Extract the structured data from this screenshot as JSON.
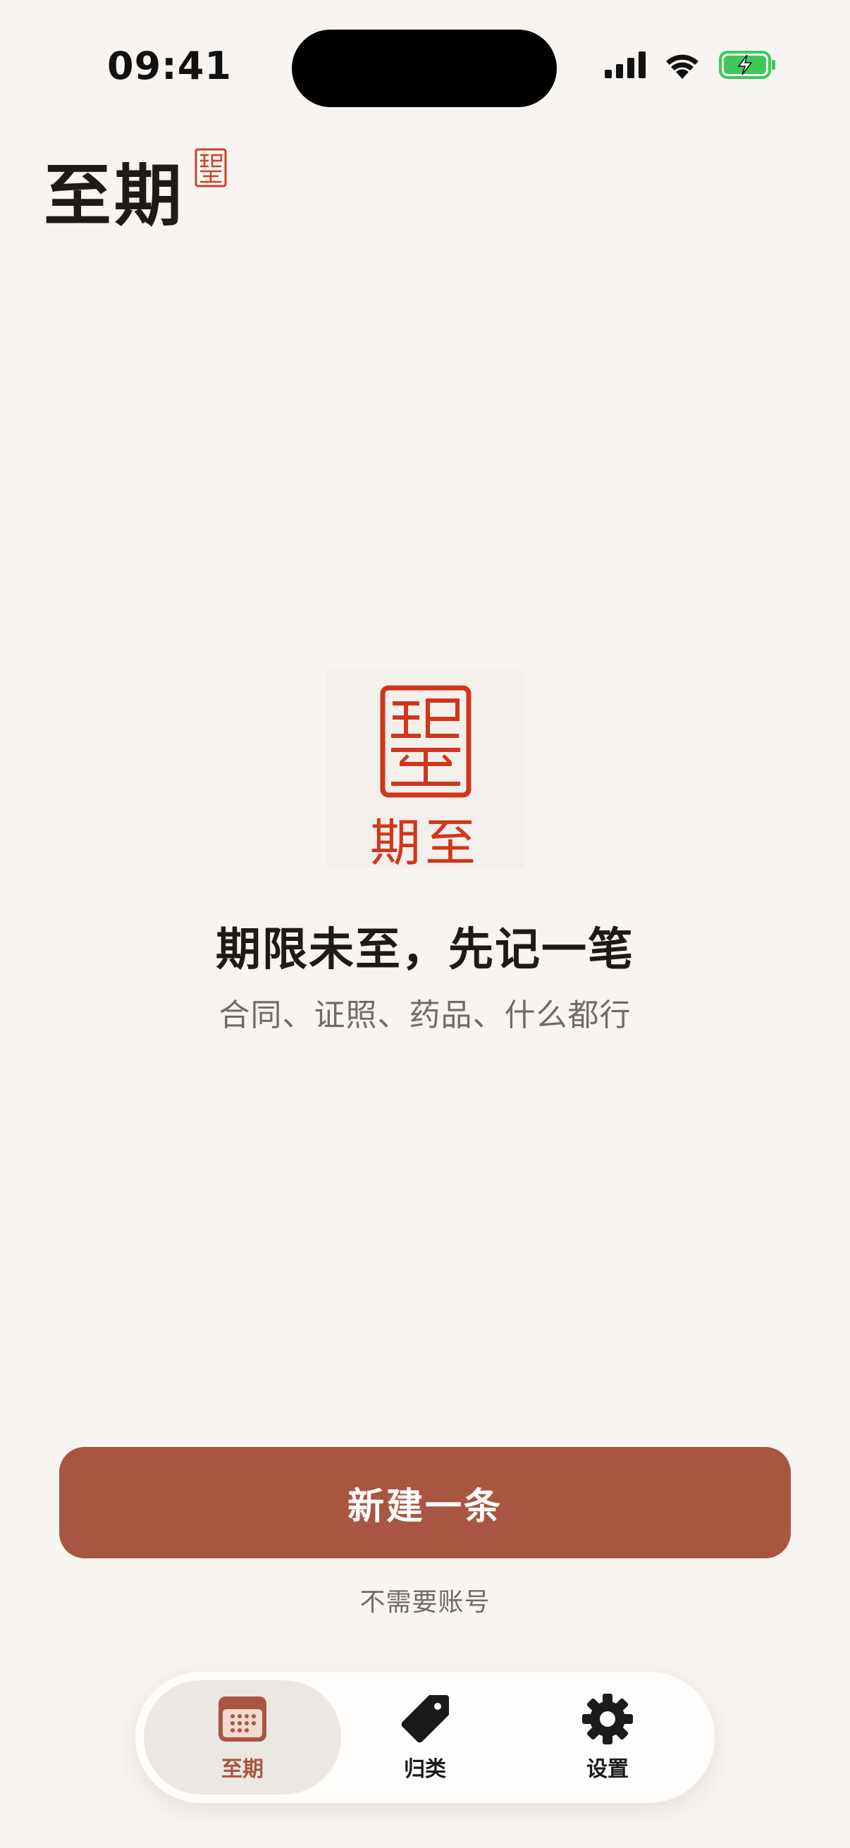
{
  "status_bar": {
    "time": "09:41",
    "icons": [
      "signal-icon",
      "wifi-icon",
      "battery-charging-icon"
    ]
  },
  "header": {
    "title": "至期",
    "seal_icon": "seal-icon"
  },
  "empty_state": {
    "logo_icon": "seal-logo-icon",
    "logo_text": "期至",
    "heading": "期限未至，先记一笔",
    "subtitle": "合同、证照、药品、什么都行"
  },
  "cta": {
    "new_label": "新建一条",
    "note": "不需要账号"
  },
  "tab_bar": {
    "tabs": [
      {
        "label": "至期",
        "icon": "calendar-icon",
        "active": true
      },
      {
        "label": "归类",
        "icon": "tag-icon",
        "active": false
      },
      {
        "label": "设置",
        "icon": "gear-icon",
        "active": false
      }
    ]
  },
  "colors": {
    "accent": "#a85641",
    "seal_red": "#d0361d",
    "background": "#f8f4f1",
    "battery_green": "#3bc95c"
  }
}
